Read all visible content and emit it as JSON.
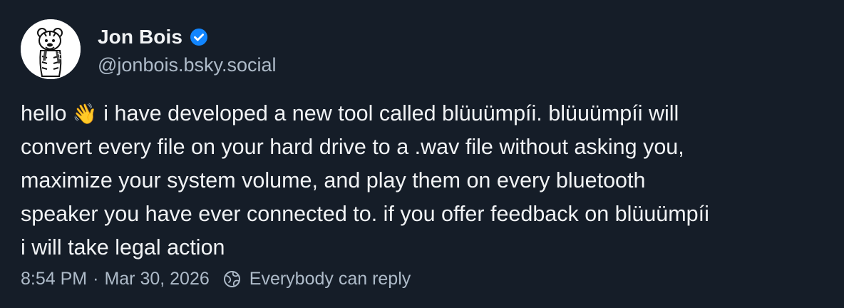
{
  "author": {
    "display_name": "Jon Bois",
    "handle": "@jonbois.bsky.social",
    "verified": true,
    "avatar_icon": "cartoon-tiger-avatar",
    "verified_color": "#1185fe"
  },
  "post": {
    "text_before_emoji": "hello ",
    "emoji": "👋",
    "text_after_emoji": " i have developed a new tool called blüuümpíi. blüuümpíi will\nconvert every file on your hard drive to a .wav file without asking you,\nmaximize your system volume, and play them on every bluetooth\nspeaker you have ever connected to. if you offer feedback on blüuümpíi\ni will take legal action"
  },
  "meta": {
    "time": "8:54 PM",
    "separator": "·",
    "date": "Mar 30, 2026",
    "reply_icon": "earth-no-lock-icon",
    "reply_setting": "Everybody can reply"
  },
  "colors": {
    "background": "#151d28",
    "text": "#f1f3f5",
    "muted": "#aebbc9"
  }
}
